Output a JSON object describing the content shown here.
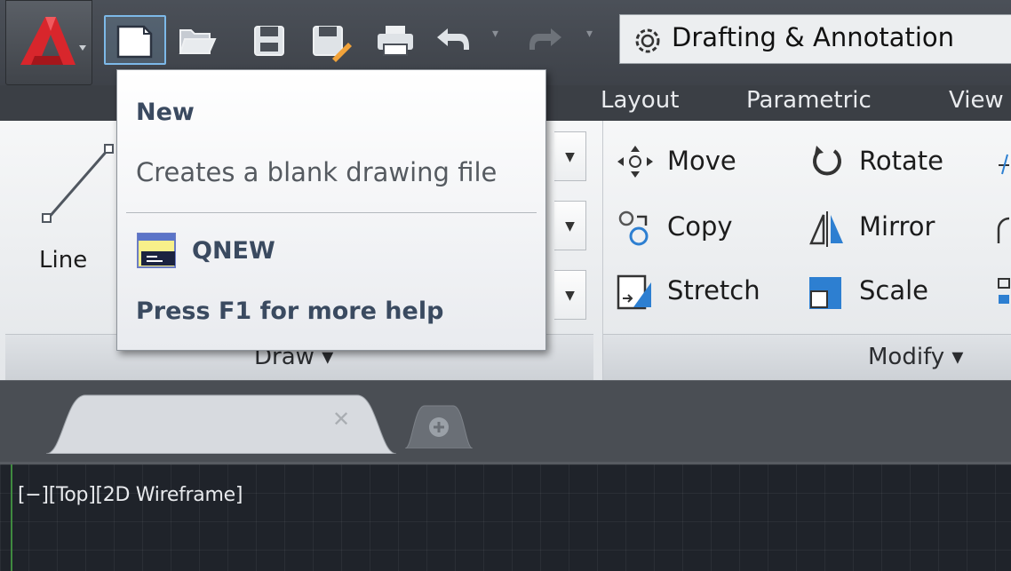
{
  "qat": {
    "workspace_label": "Drafting & Annotation",
    "buttons": [
      "new",
      "open",
      "save",
      "save-as",
      "plot",
      "undo",
      "redo"
    ]
  },
  "ribbon_tabs": [
    "Layout",
    "Parametric",
    "View"
  ],
  "draw_panel": {
    "title": "Draw",
    "line_label": "Line"
  },
  "modify_panel": {
    "title": "Modify",
    "tools": [
      "Move",
      "Rotate",
      "Copy",
      "Mirror",
      "Stretch",
      "Scale"
    ]
  },
  "tooltip": {
    "title": "New",
    "description": "Creates a blank drawing file",
    "command": "QNEW",
    "help": "Press F1 for more help"
  },
  "viewport": {
    "label": "[−][Top][2D Wireframe]"
  },
  "colors": {
    "accent_highlight": "#7db9e8",
    "app_logo": "#d8262c",
    "viewport_bg": "#1f232a"
  }
}
